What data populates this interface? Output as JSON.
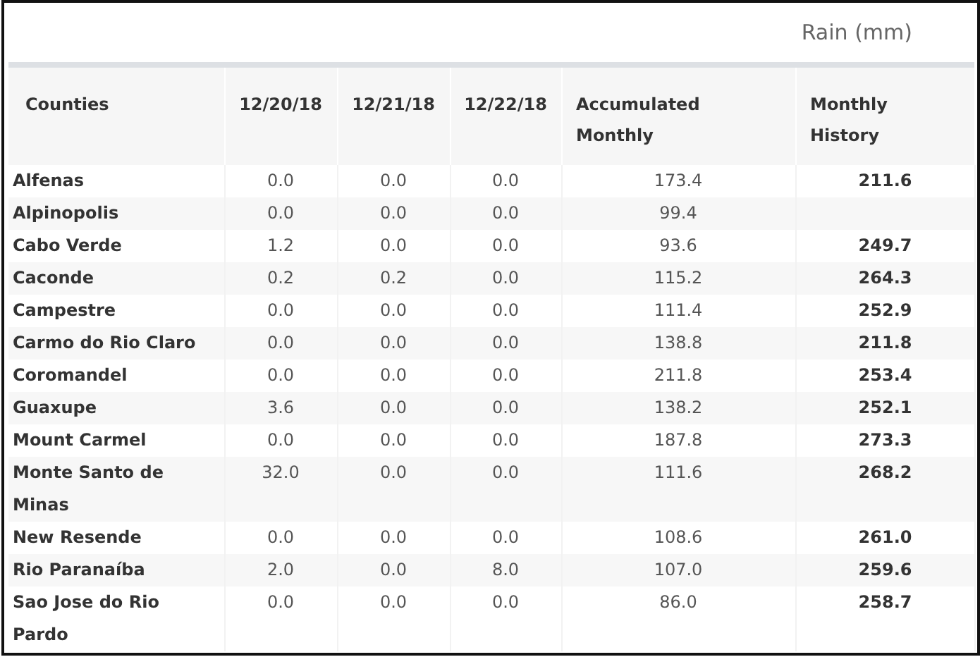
{
  "title": "Rain (mm)",
  "table": {
    "columns": [
      "Counties",
      "12/20/18",
      "12/21/18",
      "12/22/18",
      "Accumulated Monthly",
      "Monthly History"
    ],
    "rows": [
      {
        "county": "Alfenas",
        "d1": "0.0",
        "d2": "0.0",
        "d3": "0.0",
        "accumulated": "173.4",
        "history": "211.6"
      },
      {
        "county": "Alpinopolis",
        "d1": "0.0",
        "d2": "0.0",
        "d3": "0.0",
        "accumulated": "99.4"
      },
      {
        "county": "Cabo Verde",
        "d1": "1.2",
        "d2": "0.0",
        "d3": "0.0",
        "accumulated": "93.6",
        "history": "249.7"
      },
      {
        "county": "Caconde",
        "d1": "0.2",
        "d2": "0.2",
        "d3": "0.0",
        "accumulated": "115.2",
        "history": "264.3"
      },
      {
        "county": "Campestre",
        "d1": "0.0",
        "d2": "0.0",
        "d3": "0.0",
        "accumulated": "111.4",
        "history": "252.9"
      },
      {
        "county": "Carmo do Rio Claro",
        "d1": "0.0",
        "d2": "0.0",
        "d3": "0.0",
        "accumulated": "138.8",
        "history": "211.8"
      },
      {
        "county": "Coromandel",
        "d1": "0.0",
        "d2": "0.0",
        "d3": "0.0",
        "accumulated": "211.8",
        "history": "253.4"
      },
      {
        "county": "Guaxupe",
        "d1": "3.6",
        "d2": "0.0",
        "d3": "0.0",
        "accumulated": "138.2",
        "history": "252.1"
      },
      {
        "county": "Mount Carmel",
        "d1": "0.0",
        "d2": "0.0",
        "d3": "0.0",
        "accumulated": "187.8",
        "history": "273.3"
      },
      {
        "county": "Monte Santo de Minas",
        "d1": "32.0",
        "d2": "0.0",
        "d3": "0.0",
        "accumulated": "111.6",
        "history": "268.2"
      },
      {
        "county": "New Resende",
        "d1": "0.0",
        "d2": "0.0",
        "d3": "0.0",
        "accumulated": "108.6",
        "history": "261.0"
      },
      {
        "county": "Rio Paranaíba",
        "d1": "2.0",
        "d2": "0.0",
        "d3": "8.0",
        "accumulated": "107.0",
        "history": "259.6"
      },
      {
        "county": "Sao Jose do Rio Pardo",
        "d1": "0.0",
        "d2": "0.0",
        "d3": "0.0",
        "accumulated": "86.0",
        "history": "258.7"
      }
    ]
  }
}
